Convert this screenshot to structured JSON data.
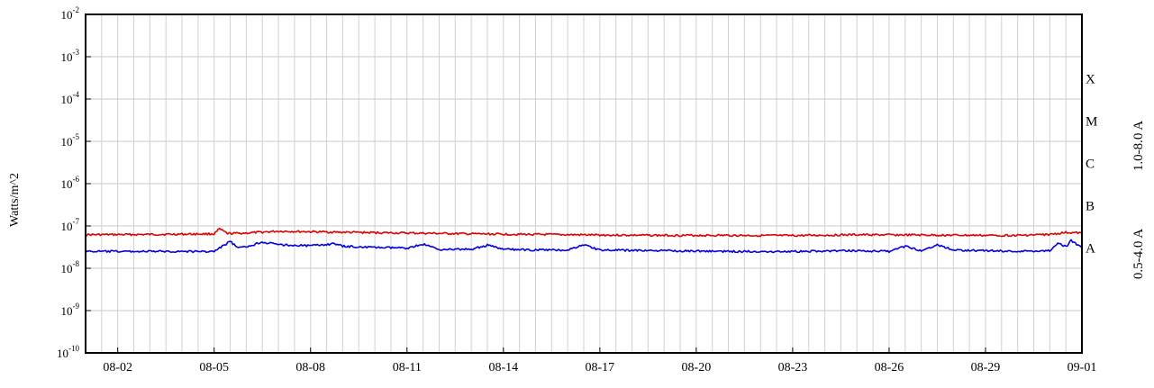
{
  "chart_data": {
    "type": "line",
    "title": "",
    "xlabel": "",
    "ylabel": "Watts/m^2",
    "y_scale": "log",
    "ylim": [
      1e-10,
      0.01
    ],
    "y_ticks": [
      {
        "value": 1e-10,
        "base": "10",
        "exp": "-10"
      },
      {
        "value": 1e-09,
        "base": "10",
        "exp": "-9"
      },
      {
        "value": 1e-08,
        "base": "10",
        "exp": "-8"
      },
      {
        "value": 1e-07,
        "base": "10",
        "exp": "-7"
      },
      {
        "value": 1e-06,
        "base": "10",
        "exp": "-6"
      },
      {
        "value": 1e-05,
        "base": "10",
        "exp": "-5"
      },
      {
        "value": 0.0001,
        "base": "10",
        "exp": "-4"
      },
      {
        "value": 0.001,
        "base": "10",
        "exp": "-3"
      },
      {
        "value": 0.01,
        "base": "10",
        "exp": "-2"
      }
    ],
    "x_type": "date",
    "xlim": [
      "2024-08-01",
      "2024-09-01"
    ],
    "x_ticks": [
      {
        "date": "2024-08-02",
        "label": "08-02"
      },
      {
        "date": "2024-08-05",
        "label": "08-05"
      },
      {
        "date": "2024-08-08",
        "label": "08-08"
      },
      {
        "date": "2024-08-11",
        "label": "08-11"
      },
      {
        "date": "2024-08-14",
        "label": "08-14"
      },
      {
        "date": "2024-08-17",
        "label": "08-17"
      },
      {
        "date": "2024-08-20",
        "label": "08-20"
      },
      {
        "date": "2024-08-23",
        "label": "08-23"
      },
      {
        "date": "2024-08-26",
        "label": "08-26"
      },
      {
        "date": "2024-08-29",
        "label": "08-29"
      },
      {
        "date": "2024-09-01",
        "label": "09-01"
      }
    ],
    "grid": true,
    "flare_classes": [
      {
        "label": "X",
        "value": 0.0003
      },
      {
        "label": "M",
        "value": 3e-05
      },
      {
        "label": "C",
        "value": 3e-06
      },
      {
        "label": "B",
        "value": 3e-07
      },
      {
        "label": "A",
        "value": 3e-08
      }
    ],
    "series": [
      {
        "name": "1.0-8.0 A",
        "color": "#e00000",
        "points": [
          {
            "x": "2024-08-01",
            "y": 6.2e-08
          },
          {
            "x": "2024-08-03",
            "y": 6.3e-08
          },
          {
            "x": "2024-08-05",
            "y": 6.5e-08
          },
          {
            "x": "2024-08-05 04:00",
            "y": 8.5e-08
          },
          {
            "x": "2024-08-05 10:00",
            "y": 6.6e-08
          },
          {
            "x": "2024-08-06",
            "y": 6.8e-08
          },
          {
            "x": "2024-08-07",
            "y": 7.5e-08
          },
          {
            "x": "2024-08-08",
            "y": 7.3e-08
          },
          {
            "x": "2024-08-09",
            "y": 7.1e-08
          },
          {
            "x": "2024-08-11",
            "y": 6.8e-08
          },
          {
            "x": "2024-08-13",
            "y": 6.5e-08
          },
          {
            "x": "2024-08-15",
            "y": 6.3e-08
          },
          {
            "x": "2024-08-17",
            "y": 6.1e-08
          },
          {
            "x": "2024-08-19",
            "y": 6e-08
          },
          {
            "x": "2024-08-21",
            "y": 6e-08
          },
          {
            "x": "2024-08-23",
            "y": 5.9e-08
          },
          {
            "x": "2024-08-25",
            "y": 6.2e-08
          },
          {
            "x": "2024-08-27",
            "y": 6.1e-08
          },
          {
            "x": "2024-08-29",
            "y": 6e-08
          },
          {
            "x": "2024-08-30",
            "y": 6e-08
          },
          {
            "x": "2024-08-31",
            "y": 6.3e-08
          },
          {
            "x": "2024-08-31 12:00",
            "y": 7e-08
          },
          {
            "x": "2024-09-01",
            "y": 6.8e-08
          }
        ]
      },
      {
        "name": "0.5-4.0 A",
        "color": "#0000e0",
        "points": [
          {
            "x": "2024-08-01",
            "y": 2.5e-08
          },
          {
            "x": "2024-08-03",
            "y": 2.5e-08
          },
          {
            "x": "2024-08-05",
            "y": 2.5e-08
          },
          {
            "x": "2024-08-05 12:00",
            "y": 4.3e-08
          },
          {
            "x": "2024-08-05 18:00",
            "y": 3e-08
          },
          {
            "x": "2024-08-06",
            "y": 3.2e-08
          },
          {
            "x": "2024-08-06 12:00",
            "y": 4.2e-08
          },
          {
            "x": "2024-08-07",
            "y": 3.6e-08
          },
          {
            "x": "2024-08-08",
            "y": 3.4e-08
          },
          {
            "x": "2024-08-08 18:00",
            "y": 3.8e-08
          },
          {
            "x": "2024-08-09",
            "y": 3.3e-08
          },
          {
            "x": "2024-08-10",
            "y": 3.1e-08
          },
          {
            "x": "2024-08-11",
            "y": 3e-08
          },
          {
            "x": "2024-08-11 12:00",
            "y": 3.7e-08
          },
          {
            "x": "2024-08-12",
            "y": 2.8e-08
          },
          {
            "x": "2024-08-13",
            "y": 2.8e-08
          },
          {
            "x": "2024-08-13 12:00",
            "y": 3.5e-08
          },
          {
            "x": "2024-08-14",
            "y": 2.8e-08
          },
          {
            "x": "2024-08-15",
            "y": 2.7e-08
          },
          {
            "x": "2024-08-16",
            "y": 2.7e-08
          },
          {
            "x": "2024-08-16 12:00",
            "y": 3.6e-08
          },
          {
            "x": "2024-08-17",
            "y": 2.7e-08
          },
          {
            "x": "2024-08-19",
            "y": 2.6e-08
          },
          {
            "x": "2024-08-21",
            "y": 2.5e-08
          },
          {
            "x": "2024-08-23",
            "y": 2.5e-08
          },
          {
            "x": "2024-08-25",
            "y": 2.6e-08
          },
          {
            "x": "2024-08-26",
            "y": 2.5e-08
          },
          {
            "x": "2024-08-26 12:00",
            "y": 3.3e-08
          },
          {
            "x": "2024-08-27",
            "y": 2.6e-08
          },
          {
            "x": "2024-08-27 12:00",
            "y": 3.6e-08
          },
          {
            "x": "2024-08-28",
            "y": 2.7e-08
          },
          {
            "x": "2024-08-29",
            "y": 2.6e-08
          },
          {
            "x": "2024-08-30",
            "y": 2.5e-08
          },
          {
            "x": "2024-08-31",
            "y": 2.6e-08
          },
          {
            "x": "2024-08-31 06:00",
            "y": 4e-08
          },
          {
            "x": "2024-08-31 12:00",
            "y": 3.2e-08
          },
          {
            "x": "2024-08-31 16:00",
            "y": 4.6e-08
          },
          {
            "x": "2024-09-01",
            "y": 3e-08
          }
        ]
      }
    ]
  }
}
